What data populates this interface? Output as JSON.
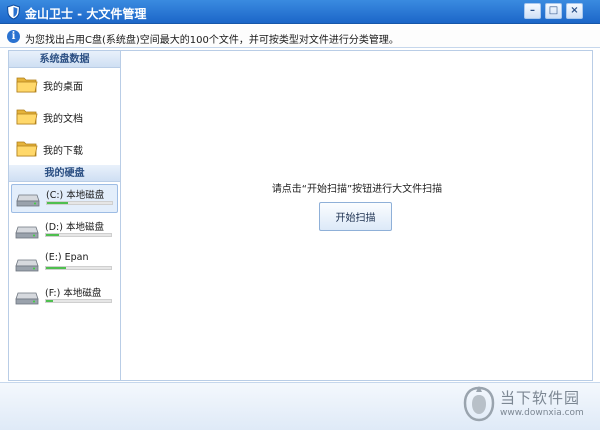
{
  "window": {
    "title": "金山卫士 - 大文件管理",
    "controls": {
      "minimize": "–",
      "maximize": "□",
      "close": "×"
    }
  },
  "info": {
    "icon": "info-icon",
    "text": "为您找出占用C盘(系统盘)空间最大的100个文件，并可按类型对文件进行分类管理。"
  },
  "sidebar": {
    "system_header": "系统盘数据",
    "folders": [
      {
        "label": "我的桌面",
        "icon": "folder-icon"
      },
      {
        "label": "我的文档",
        "icon": "folder-icon"
      },
      {
        "label": "我的下载",
        "icon": "folder-icon"
      }
    ],
    "disks_header": "我的硬盘",
    "disks": [
      {
        "label": "(C:) 本地磁盘",
        "usage": 0.32,
        "selected": true
      },
      {
        "label": "(D:) 本地磁盘",
        "usage": 0.2,
        "selected": false
      },
      {
        "label": "(E:) Epan",
        "usage": 0.3,
        "selected": false
      },
      {
        "label": "(F:) 本地磁盘",
        "usage": 0.1,
        "selected": false
      }
    ]
  },
  "main": {
    "prompt": "请点击“开始扫描”按钮进行大文件扫描",
    "scan_button": "开始扫描"
  },
  "watermark": {
    "name": "当下软件园",
    "url": "www.downxia.com"
  },
  "colors": {
    "titlebar": "#1c66c8",
    "accent": "#2a72d0",
    "disk_fill": "#4fbf4f"
  }
}
